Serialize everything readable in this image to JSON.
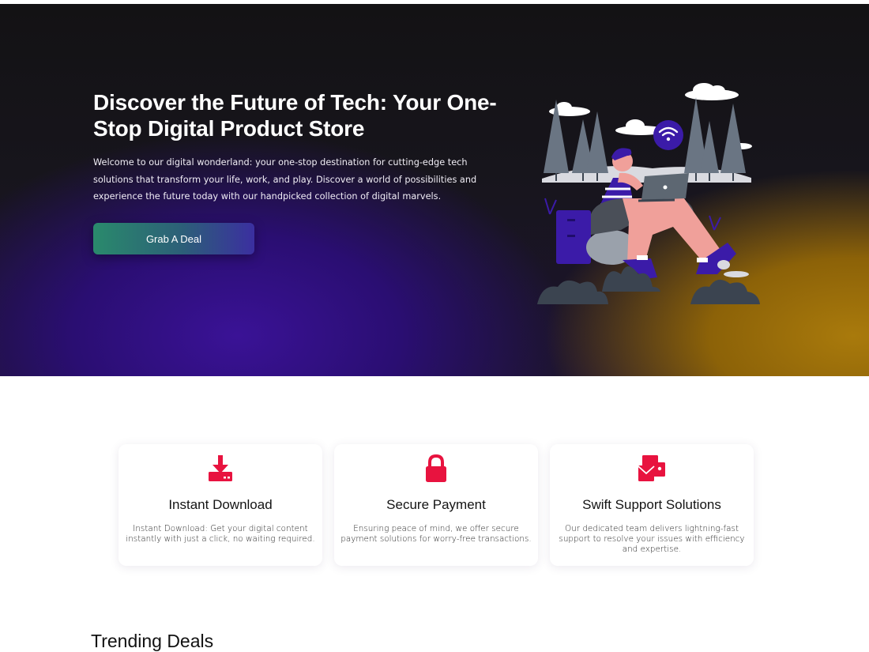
{
  "hero": {
    "title": "Discover the Future of Tech: Your One-Stop Digital Product Store",
    "description": "Welcome to our digital wonderland: your one-stop destination for cutting-edge tech solutions that transform your life, work, and play. Discover a world of possibilities and experience the future today with our handpicked collection of digital marvels.",
    "cta_label": "Grab A Deal",
    "illustration_icon": "person-with-laptop-illustration"
  },
  "features": [
    {
      "icon": "download-icon",
      "title": "Instant Download",
      "text": "Instant Download: Get your digital content instantly with just a click, no waiting required."
    },
    {
      "icon": "lock-icon",
      "title": "Secure Payment",
      "text": "Ensuring peace of mind, we offer secure payment solutions for worry-free transactions."
    },
    {
      "icon": "mail-support-icon",
      "title": "Swift Support Solutions",
      "text": "Our dedicated team delivers lightning-fast support to resolve your issues with efficiency and expertise."
    }
  ],
  "trending": {
    "title": "Trending Deals"
  },
  "colors": {
    "accent": "#e8133f",
    "hero_purple": "#3a1296",
    "hero_gold": "#a97a0c",
    "cta_start": "#2a8a6c",
    "cta_end": "#3b2fa0"
  }
}
